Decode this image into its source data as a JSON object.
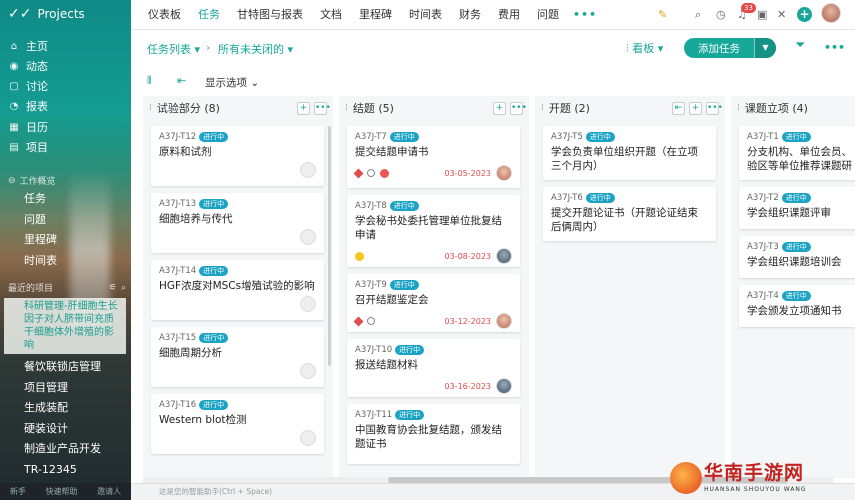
{
  "app": {
    "name": "Projects"
  },
  "sidebar": {
    "nav": [
      {
        "icon": "home-icon",
        "label": "主页",
        "glyph": "⌂"
      },
      {
        "icon": "activity-icon",
        "label": "动态",
        "glyph": "◉"
      },
      {
        "icon": "discussion-icon",
        "label": "讨论",
        "glyph": "▢"
      },
      {
        "icon": "report-icon",
        "label": "报表",
        "glyph": "◔"
      },
      {
        "icon": "calendar-icon",
        "label": "日历",
        "glyph": "▦"
      },
      {
        "icon": "project-icon",
        "label": "项目",
        "glyph": "▤"
      }
    ],
    "work_section": "工作概览",
    "work_items": [
      "任务",
      "问题",
      "里程碑",
      "时间表"
    ],
    "recent_section": "最近的项目",
    "recent_highlight": "科研管理-肝细胞生长因子对人脐带间充质干细胞体外增殖的影响",
    "recent_items": [
      "餐饮联锁店管理",
      "项目管理",
      "生成装配",
      "硬装设计",
      "制造业产品开发",
      "TR-12345"
    ],
    "footer": [
      "新手",
      "快速帮助",
      "邀请人"
    ]
  },
  "topbar": {
    "tabs": [
      "仪表板",
      "任务",
      "甘特图与报表",
      "文档",
      "里程碑",
      "时间表",
      "财务",
      "费用",
      "问题"
    ],
    "active_tab": "任务",
    "more": "•••",
    "notification_count": "33"
  },
  "toolbar": {
    "task_list": "任务列表 ▾",
    "filter": "所有未关闭的",
    "view": "看板 ▾",
    "add_task": "添加任务",
    "display_options": "显示选项"
  },
  "columns": [
    {
      "title": "试验部分 (8)",
      "cards": [
        {
          "id": "A37J-T12",
          "status": "进行中",
          "title": "原料和试剂"
        },
        {
          "id": "A37J-T13",
          "status": "进行中",
          "title": "细胞培养与传代"
        },
        {
          "id": "A37J-T14",
          "status": "进行中",
          "title": "HGF浓度对MSCs增殖试验的影响"
        },
        {
          "id": "A37J-T15",
          "status": "进行中",
          "title": "细胞周期分析"
        },
        {
          "id": "A37J-T16",
          "status": "进行中",
          "title": "Western blot检测"
        }
      ]
    },
    {
      "title": "结题 (5)",
      "cards": [
        {
          "id": "A37J-T7",
          "status": "进行中",
          "title": "提交结题申请书",
          "date": "03-05-2023"
        },
        {
          "id": "A37J-T8",
          "status": "进行中",
          "title": "学会秘书处委托管理单位批复结申请",
          "date": "03-08-2023"
        },
        {
          "id": "A37J-T9",
          "status": "进行中",
          "title": "召开结题鉴定会",
          "date": "03-12-2023"
        },
        {
          "id": "A37J-T10",
          "status": "进行中",
          "title": "报送结题材料",
          "date": "03-16-2023"
        },
        {
          "id": "A37J-T11",
          "status": "进行中",
          "title": "中国教育协会批复结题，颁发结题证书"
        }
      ]
    },
    {
      "title": "开题 (2)",
      "cards": [
        {
          "id": "A37J-T5",
          "status": "进行中",
          "title": "学会负责单位组织开题（在立项三个月内）"
        },
        {
          "id": "A37J-T6",
          "status": "进行中",
          "title": "提交开题论证书（开题论证结束后俩周内）"
        }
      ]
    },
    {
      "title": "课题立项 (4)",
      "cards": [
        {
          "id": "A37J-T1",
          "status": "进行中",
          "title": "分支机构、单位会员、验区等单位推荐课题研"
        },
        {
          "id": "A37J-T2",
          "status": "进行中",
          "title": "学会组织课题评审"
        },
        {
          "id": "A37J-T3",
          "status": "进行中",
          "title": "学会组织课题培训会"
        },
        {
          "id": "A37J-T4",
          "status": "进行中",
          "title": "学会颁发立项通知书"
        }
      ]
    }
  ],
  "footbar": {
    "hint": "这是您的智能助手(Ctrl + Space)"
  },
  "watermark": {
    "text": "华南手游网",
    "sub": "HUANSAN SHOUYOU WANG"
  }
}
